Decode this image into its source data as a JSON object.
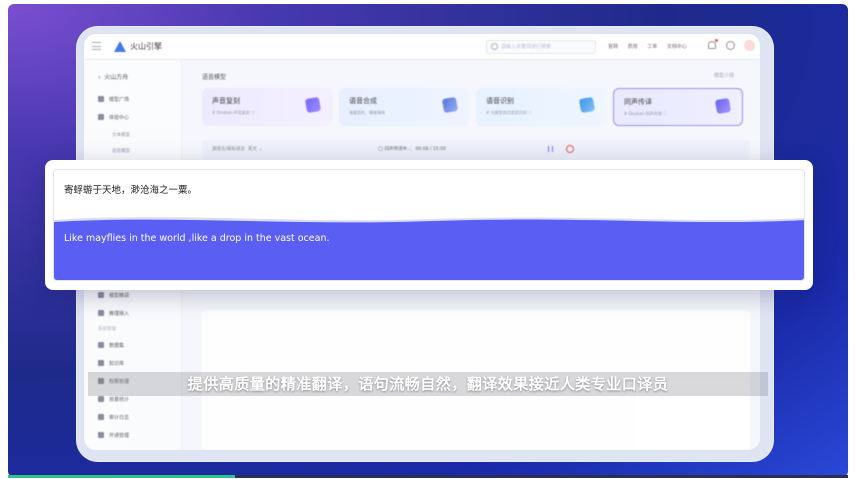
{
  "app": {
    "brand": "火山引擎",
    "search_placeholder": "请输入关键词进行搜索",
    "top_links": [
      "官网",
      "费用",
      "工单",
      "文档中心"
    ]
  },
  "sidebar": {
    "back_label": "火山方舟",
    "items": [
      {
        "label": "模型广场",
        "top": 0
      },
      {
        "label": "体验中心",
        "top": 1
      }
    ],
    "subitems": [
      "文本模型",
      "语音模型"
    ],
    "lower_items": [
      "模型精调",
      "推理接入"
    ],
    "groups": [
      "系统管理"
    ],
    "bottom_items": [
      "数据集",
      "知识库",
      "权限管理",
      "用量统计",
      "审计日志",
      "开通管理"
    ]
  },
  "main": {
    "breadcrumb": "语音模型",
    "right_link": "模型介绍",
    "cards": [
      {
        "title": "声音复刻",
        "sub": "# Doubao-声音复刻 ⓘ"
      },
      {
        "title": "语音合成",
        "sub": "海量音色、情感演绎"
      },
      {
        "title": "语音识别",
        "sub": "# 大模型流式语音识别 ⓘ"
      },
      {
        "title": "同声传译",
        "sub": "# Doubao-同声传译 ⓘ"
      }
    ],
    "workbar": {
      "select_label": "源语言/目标语言",
      "select_value": "英文",
      "status": "同声传译中...",
      "timer": "00:08 / 15:00"
    }
  },
  "translation": {
    "source": "寄蜉蝣于天地，渺沧海之一粟。",
    "target": "Like mayflies in the world ,like a drop in the vast ocean."
  },
  "subtitle": "提供高质量的精准翻译，语句流畅自然，翻译效果接近人类专业口译员",
  "progress": 0.27,
  "colors": {
    "accent": "#5b5ef2",
    "brand_blue": "#2f6fe6"
  }
}
